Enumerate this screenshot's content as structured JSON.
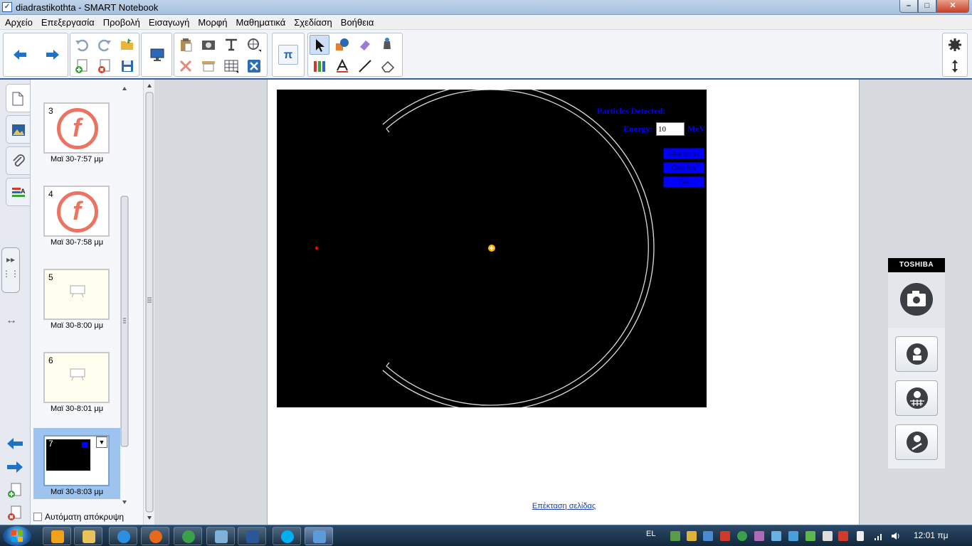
{
  "window": {
    "title": "diadrastikothta - SMART Notebook",
    "app_icon": "smart-notebook-icon",
    "controls": {
      "minimize": "–",
      "maximize": "□",
      "close": "✕"
    }
  },
  "menu": [
    "Αρχείο",
    "Επεξεργασία",
    "Προβολή",
    "Εισαγωγή",
    "Μορφή",
    "Μαθηματικά",
    "Σχεδίαση",
    "Βοήθεια"
  ],
  "toolbar": {
    "groups": [
      "navigation",
      "undo-redo-file",
      "display",
      "insert",
      "math",
      "drawing-tools",
      "settings"
    ]
  },
  "sorter": {
    "pages": [
      {
        "number": "3",
        "label": "Μαϊ 30-7:57 μμ",
        "content": "logo"
      },
      {
        "number": "4",
        "label": "Μαϊ 30-7:58 μμ",
        "content": "logo"
      },
      {
        "number": "5",
        "label": "Μαϊ 30-8:00 μμ",
        "content": "blank"
      },
      {
        "number": "6",
        "label": "Μαϊ 30-8:01 μμ",
        "content": "blank"
      },
      {
        "number": "7",
        "label": "Μαϊ 30-8:03 μμ",
        "content": "simulation",
        "selected": true
      }
    ],
    "logo_letter": "f",
    "autohide_label": "Αυτόματη απόκρυψη"
  },
  "simulation": {
    "particles_label": "Particles Detected:",
    "energy_label": "Energy:",
    "energy_value": "10",
    "energy_unit": "MeV",
    "buttons": [
      "Clear tracks",
      "Clear hits",
      "Fire"
    ],
    "colors": {
      "background": "#000000",
      "text": "#0000ff",
      "button": "#0000ff",
      "nucleus": "#ffb000",
      "particle": "#ff0000"
    }
  },
  "page": {
    "extend_link": "Επέκταση σελίδας"
  },
  "camera_widget": {
    "brand": "TOSHIBA"
  },
  "taskbar": {
    "apps": [
      "media-player",
      "explorer",
      "internet-explorer",
      "firefox",
      "utorrent",
      "network-app",
      "word",
      "skype",
      "smart-notebook"
    ],
    "language": "EL",
    "clock": "12:01 πμ"
  }
}
